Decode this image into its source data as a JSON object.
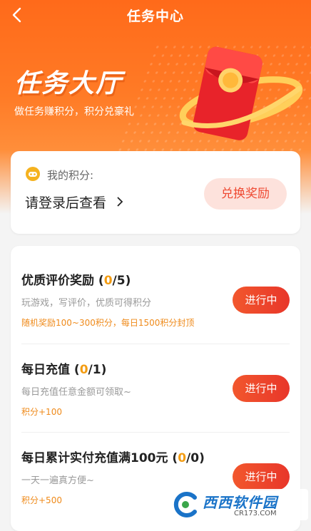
{
  "header": {
    "title": "任务中心",
    "back_icon": "chevron-left-icon"
  },
  "hero": {
    "title": "任务大厅",
    "subtitle": "做任务赚积分，积分兑豪礼",
    "illustration": "red-envelope-icon"
  },
  "points_card": {
    "coin_icon": "game-coin-icon",
    "label": "我的积分:",
    "login_text": "请登录后查看",
    "exchange_label": "兑换奖励"
  },
  "tasks": [
    {
      "title": "优质评价奖励",
      "done": "0",
      "total": "5",
      "desc": "玩游戏，写评价，优质可得积分",
      "reward": "随机奖励100~300积分，每日1500积分封顶",
      "status": "进行中"
    },
    {
      "title": "每日充值",
      "done": "0",
      "total": "1",
      "desc": "每日充值任意金额可领取~",
      "reward": "积分+100",
      "status": "进行中"
    },
    {
      "title": "每日累计实付充值满100元",
      "done": "0",
      "total": "0",
      "desc": "一天一遍真方便~",
      "reward": "积分+500",
      "status": "进行中"
    }
  ],
  "watermark": {
    "name": "西西软件园",
    "domain": "CR173.COM"
  },
  "colors": {
    "primary": "#ff6a1a",
    "button": "#e8362a",
    "accent": "#f39c12"
  }
}
